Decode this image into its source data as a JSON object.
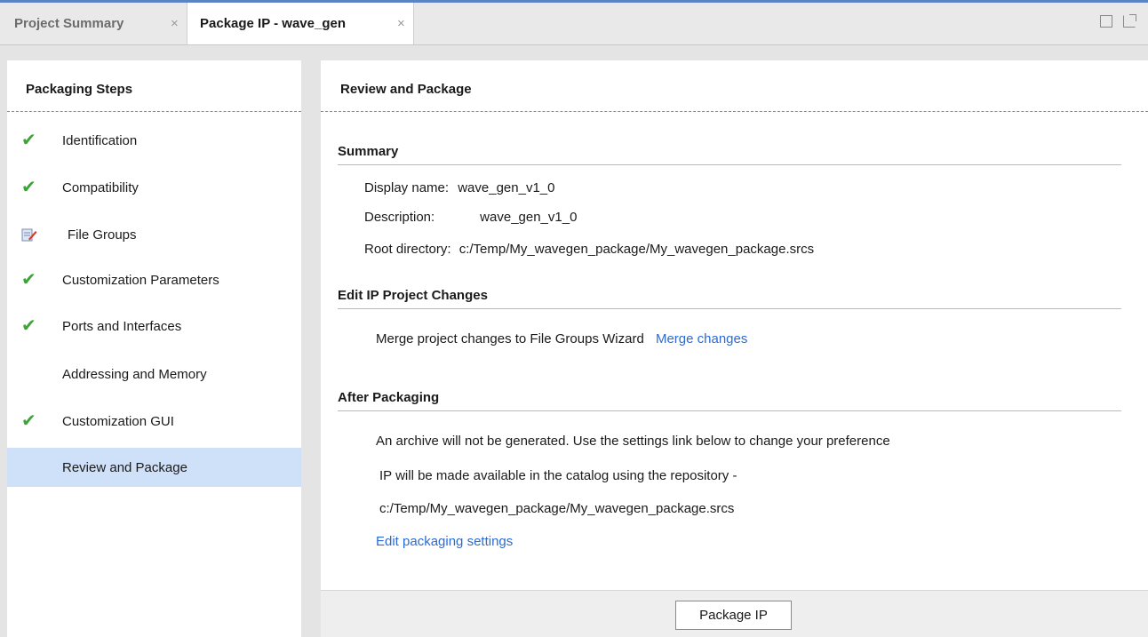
{
  "tabs": [
    {
      "label": "Project Summary",
      "close": "×"
    },
    {
      "label": "Package IP - wave_gen",
      "close": "×"
    }
  ],
  "window_icons": [
    "maximize-icon",
    "float-icon"
  ],
  "packaging_steps": {
    "title": "Packaging Steps",
    "items": [
      {
        "label": "Identification",
        "status": "complete"
      },
      {
        "label": "Compatibility",
        "status": "complete"
      },
      {
        "label": "File Groups",
        "status": "edited"
      },
      {
        "label": "Customization Parameters",
        "status": "complete"
      },
      {
        "label": "Ports and Interfaces",
        "status": "complete"
      },
      {
        "label": "Addressing and Memory",
        "status": "none"
      },
      {
        "label": "Customization GUI",
        "status": "complete"
      },
      {
        "label": "Review and Package",
        "status": "none",
        "selected": true
      }
    ]
  },
  "review": {
    "title": "Review and Package",
    "summary": {
      "heading": "Summary",
      "display_name_label": "Display name:",
      "display_name_value": "wave_gen_v1_0",
      "description_label": "Description:",
      "description_value": "wave_gen_v1_0",
      "root_dir_label": "Root directory:",
      "root_dir_value": "c:/Temp/My_wavegen_package/My_wavegen_package.srcs"
    },
    "edit_changes": {
      "heading": "Edit IP Project Changes",
      "text": "Merge project changes to File Groups Wizard",
      "link": "Merge changes"
    },
    "after_packaging": {
      "heading": "After Packaging",
      "line1": "An archive will not be generated. Use the settings link below to change your preference",
      "line2": "IP will be made available in the catalog using the repository -",
      "line3": "c:/Temp/My_wavegen_package/My_wavegen_package.srcs",
      "link": "Edit packaging settings"
    },
    "package_button": "Package IP"
  },
  "colors": {
    "accent": "#5b84c4",
    "check": "#3fa33a",
    "link": "#2a6bd8",
    "selected_row": "#cfe0f9"
  }
}
